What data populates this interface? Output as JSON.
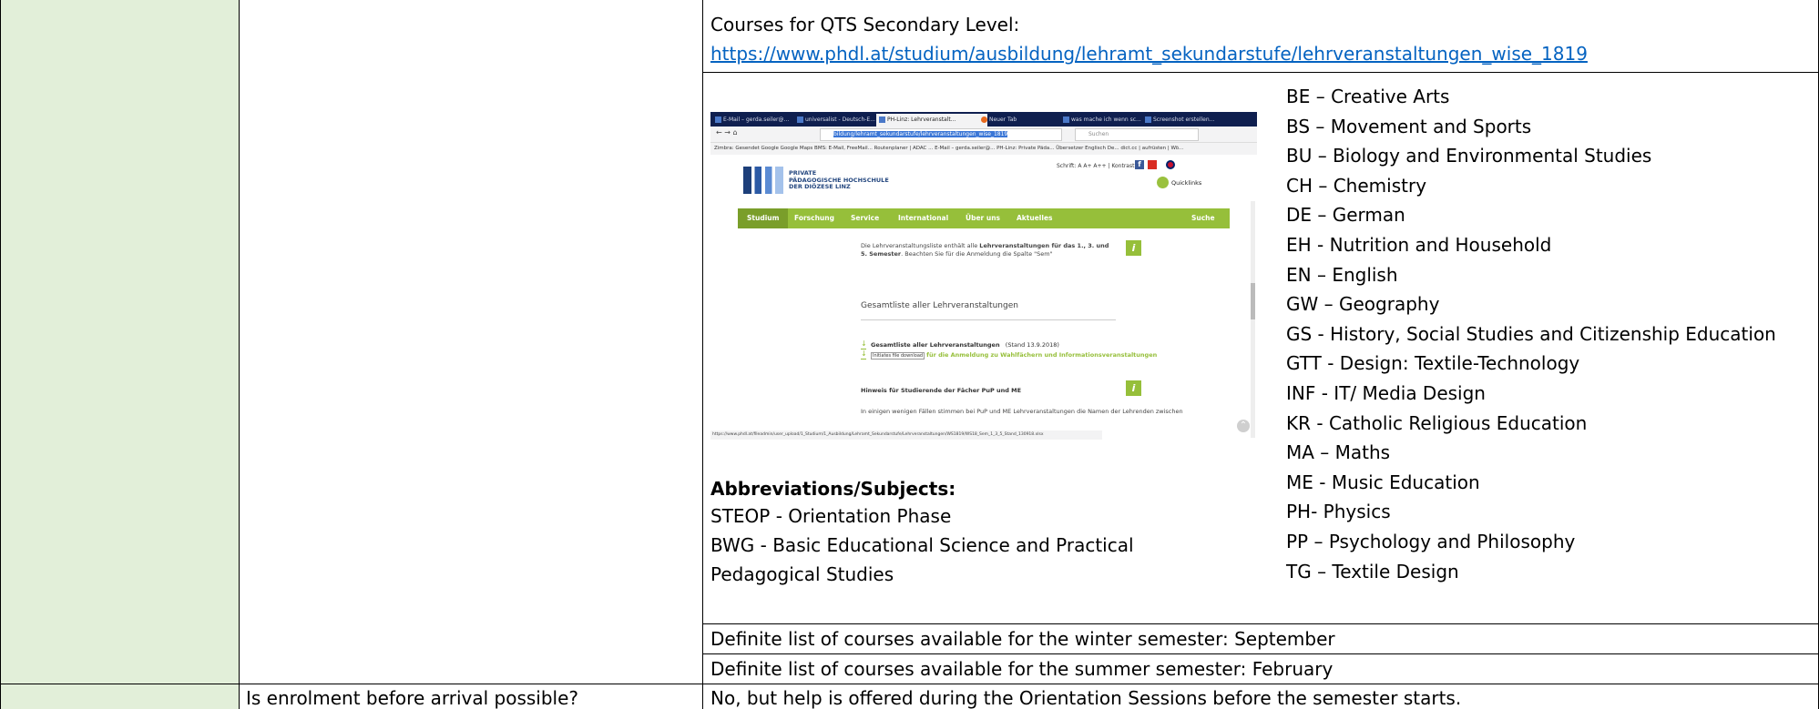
{
  "colors": {
    "green_cell": "#e2efd9",
    "link": "#0563c1",
    "site_green": "#96bf3a"
  },
  "courses_heading": "Courses for QTS Secondary Level:",
  "courses_url": "https://www.phdl.at/studium/ausbildung/lehramt_sekundarstufe/lehrveranstaltungen_wise_1819",
  "abbreviations_heading": "Abbreviations/Subjects:",
  "abbreviations_left": [
    "STEOP - Orientation Phase",
    "BWG - Basic Educational Science and Practical",
    "Pedagogical Studies"
  ],
  "abbreviations_right": [
    "BE – Creative Arts",
    "BS – Movement and Sports",
    "BU – Biology and Environmental Studies",
    "CH – Chemistry",
    "DE – German",
    "EH - Nutrition and Household",
    "EN – English",
    "GW – Geography",
    "GS - History, Social Studies and Citizenship Education",
    "GTT - Design: Textile-Technology",
    "INF - IT/ Media Design",
    "KR - Catholic Religious Education",
    "MA – Maths",
    "ME - Music Education",
    "PH- Physics",
    "PP – Psychology and Philosophy",
    "TG – Textile Design"
  ],
  "winter_note": "Definite list of courses available for the winter semester: September",
  "summer_note": "Definite list of courses available for the summer semester: February",
  "question": "Is enrolment before arrival possible?",
  "answer": "No, but help is offered during the Orientation Sessions before the semester starts.",
  "screenshot": {
    "tabs": [
      "E-Mail – gerda.seiler@...",
      "universalist - Deutsch-E...",
      "PH-Linz: Lehrveranstalt...",
      "Neuer Tab",
      "was mache ich wenn sc...",
      "Screenshot erstellen..."
    ],
    "url": "bildung/lehramt_sekundarstufe/lehrveranstaltungen_wise_1819",
    "search_placeholder": "Suchen",
    "bookmarks": "Zimbra: Gesendet   Google   Google Maps   BMS: E-Mail, FreeMail...   Routenplaner | ADAC ...   E-Mail – gerda.seiler@...   PH-Linz: Private Päda...   Übersetzer Englisch De...   dict.cc | aufrüsten | Wö...",
    "logo_line1": "PRIVATE",
    "logo_line2": "PÄDAGOGISCHE HOCHSCHULE",
    "logo_line3": "DER DIÖZESE LINZ",
    "schrift": "Schrift:  A A+ A++  |  Kontrast",
    "quicklinks": "Quicklinks",
    "nav": [
      "Studium",
      "Forschung",
      "Service",
      "International",
      "Über uns",
      "Aktuelles"
    ],
    "nav_search": "Suche",
    "info_text_a": "Die Lehrveranstaltungsliste enthält alle ",
    "info_text_b": "Lehrveranstaltungen für das 1., 3. und 5. Semester",
    "info_text_c": ". Beachten Sie für die Anmeldung die Spalte \"Sem\"",
    "section_title": "Gesamtliste aller Lehrveranstaltungen",
    "download1_bold": "Gesamtliste aller Lehrveranstaltungen",
    "download1_date": "(Stand 13.9.2018)",
    "download2_tooltip": "Initiates file download",
    "download2_text": "für die Anmeldung zu Wahlfächern und Informationsveranstaltungen",
    "hint_title": "Hinweis für Studierende der Fächer PuP und ME",
    "hint_text": "In einigen wenigen Fällen stimmen bei PuP und ME Lehrveranstaltungen die Namen der Lehrenden zwischen",
    "status_url": "https://www.phdl.at/fileadmin/user_upload/1_Studium/1_Ausbildung/Lehramt_Sekundarstufe/Lehrveranstaltungen/WS1819/WS18_Sem_1_3_5_Stand_130918.xlsx"
  }
}
